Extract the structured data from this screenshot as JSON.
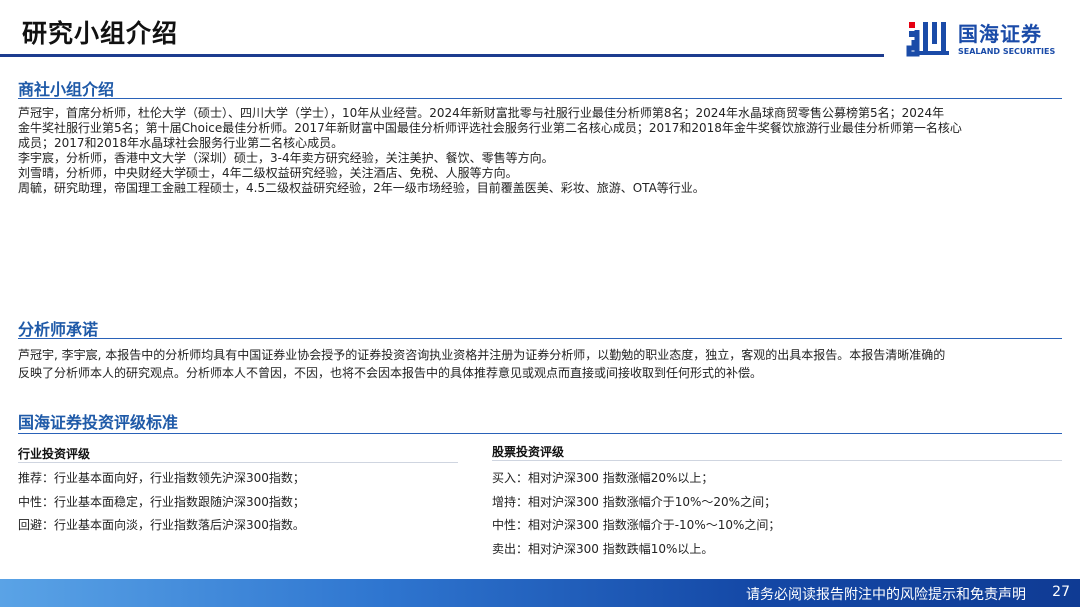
{
  "header": {
    "title": "研究小组介绍",
    "logo_cn": "国海证券",
    "logo_en": "SEALAND SECURITIES",
    "icon": "sealand-logo-icon"
  },
  "team": {
    "heading": "商社小组介绍",
    "lines": [
      "芦冠宇，首席分析师，杜伦大学（硕士）、四川大学（学士），10年从业经营。2024年新财富批零与社服行业最佳分析师第8名；2024年水晶球商贸零售公募榜第5名；2024年",
      "金牛奖社服行业第5名；第十届Choice最佳分析师。2017年新财富中国最佳分析师评选社会服务行业第二名核心成员；2017和2018年金牛奖餐饮旅游行业最佳分析师第一名核心",
      "成员；2017和2018年水晶球社会服务行业第二名核心成员。",
      "李宇宸，分析师，香港中文大学（深圳）硕士，3-4年卖方研究经验，关注美护、餐饮、零售等方向。",
      "刘雪晴，分析师，中央财经大学硕士，4年二级权益研究经验，关注酒店、免税、人服等方向。",
      "周毓，研究助理，帝国理工金融工程硕士，4.5二级权益研究经验，2年一级市场经验，目前覆盖医美、彩妆、旅游、OTA等行业。"
    ]
  },
  "commitment": {
    "heading": "分析师承诺",
    "lines": [
      "芦冠宇, 李宇宸, 本报告中的分析师均具有中国证券业协会授予的证券投资咨询执业资格并注册为证券分析师，以勤勉的职业态度，独立，客观的出具本报告。本报告清晰准确的",
      "反映了分析师本人的研究观点。分析师本人不曾因，不因，也将不会因本报告中的具体推荐意见或观点而直接或间接收取到任何形式的补偿。"
    ]
  },
  "rating": {
    "heading": "国海证券投资评级标准",
    "industry": {
      "title": "行业投资评级",
      "items": [
        "推荐：行业基本面向好，行业指数领先沪深300指数；",
        "中性：行业基本面稳定，行业指数跟随沪深300指数；",
        "回避：行业基本面向淡，行业指数落后沪深300指数。"
      ]
    },
    "stock": {
      "title": "股票投资评级",
      "items": [
        "买入：相对沪深300 指数涨幅20%以上；",
        "增持：相对沪深300 指数涨幅介于10%～20%之间；",
        "中性：相对沪深300 指数涨幅介于-10%～10%之间；",
        "卖出：相对沪深300 指数跌幅10%以上。"
      ]
    }
  },
  "footer": {
    "disclaimer": "请务必阅读报告附注中的风险提示和免责声明",
    "page": "27"
  },
  "colors": {
    "brand_blue": "#1a4ba8",
    "heading_blue": "#1f5aa8",
    "logo_red": "#e60012"
  }
}
